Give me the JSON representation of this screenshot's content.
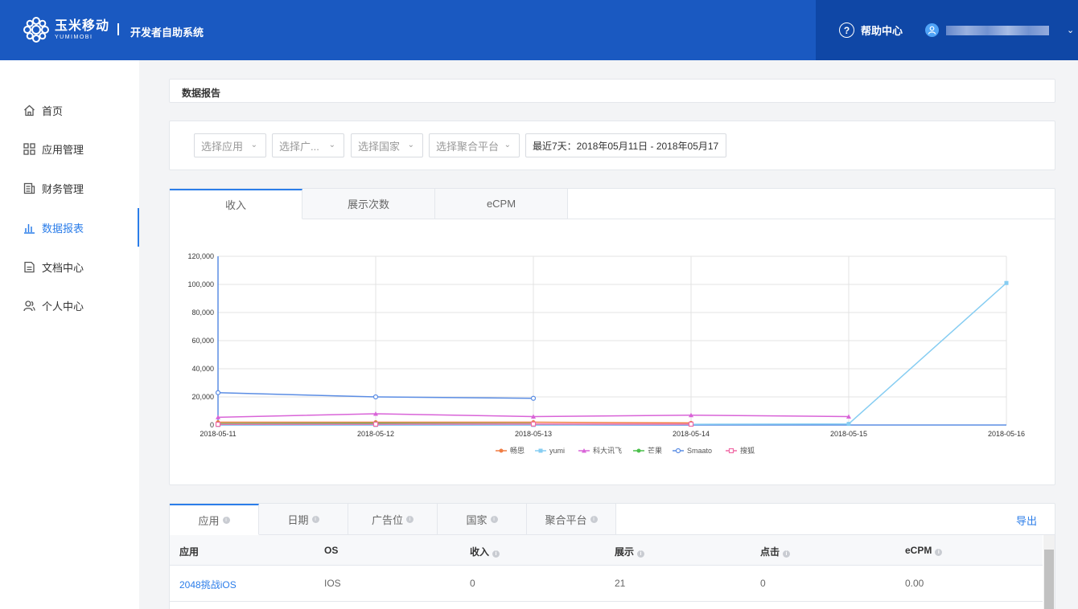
{
  "header": {
    "logo_cn": "玉米移动",
    "logo_en": "YUMIMOBI",
    "system_title": "开发者自助系统",
    "help_label": "帮助中心"
  },
  "sidebar": {
    "items": [
      {
        "label": "首页",
        "icon": "home-icon"
      },
      {
        "label": "应用管理",
        "icon": "grid-icon"
      },
      {
        "label": "财务管理",
        "icon": "ledger-icon"
      },
      {
        "label": "数据报表",
        "icon": "bar-chart-icon",
        "active": true
      },
      {
        "label": "文档中心",
        "icon": "document-icon"
      },
      {
        "label": "个人中心",
        "icon": "user-icon"
      }
    ]
  },
  "page_title": "数据报告",
  "filters": {
    "app": "选择应用",
    "ad_slot": "选择广...",
    "country": "选择国家",
    "platform": "选择聚合平台",
    "date_range": "最近7天：2018年05月11日 - 2018年05月17"
  },
  "chart_tabs": [
    "收入",
    "展示次数",
    "eCPM"
  ],
  "colors": {
    "header_bg": "#1a59c1",
    "accent": "#2b7de9"
  },
  "chart_data": {
    "type": "line",
    "x": [
      "2018-05-11",
      "2018-05-12",
      "2018-05-13",
      "2018-05-14",
      "2018-05-15",
      "2018-05-16"
    ],
    "ylim": [
      0,
      120000
    ],
    "yticks": [
      "0",
      "20,000",
      "40,000",
      "60,000",
      "80,000",
      "100,000",
      "120,000"
    ],
    "grid": true,
    "legend": "bottom-center",
    "series": [
      {
        "name": "畅思",
        "color": "#f07d44",
        "marker": "circle",
        "values": [
          2000,
          2000,
          2000,
          1500,
          null,
          null
        ]
      },
      {
        "name": "yumi",
        "color": "#86cdf2",
        "marker": "square",
        "values": [
          0,
          0,
          0,
          500,
          800,
          101000
        ]
      },
      {
        "name": "科大讯飞",
        "color": "#d964d8",
        "marker": "triangle",
        "values": [
          5500,
          8000,
          6000,
          7000,
          6000,
          null
        ]
      },
      {
        "name": "芒果",
        "color": "#4cc04c",
        "marker": "circle",
        "values": [
          1000,
          1200,
          1000,
          null,
          null,
          null
        ]
      },
      {
        "name": "Smaato",
        "color": "#5b8de4",
        "marker": "hollow-circle",
        "values": [
          23000,
          20000,
          19000,
          null,
          null,
          null
        ]
      },
      {
        "name": "搜狐",
        "color": "#f06ba6",
        "marker": "hollow-square",
        "values": [
          500,
          600,
          700,
          600,
          null,
          null
        ]
      }
    ]
  },
  "table": {
    "tabs": [
      "应用",
      "日期",
      "广告位",
      "国家",
      "聚合平台"
    ],
    "export_label": "导出",
    "columns": [
      "应用",
      "OS",
      "收入",
      "展示",
      "点击",
      "eCPM"
    ],
    "rows": [
      [
        "2048挑战iOS",
        "IOS",
        "0",
        "21",
        "0",
        "0.00"
      ]
    ]
  }
}
